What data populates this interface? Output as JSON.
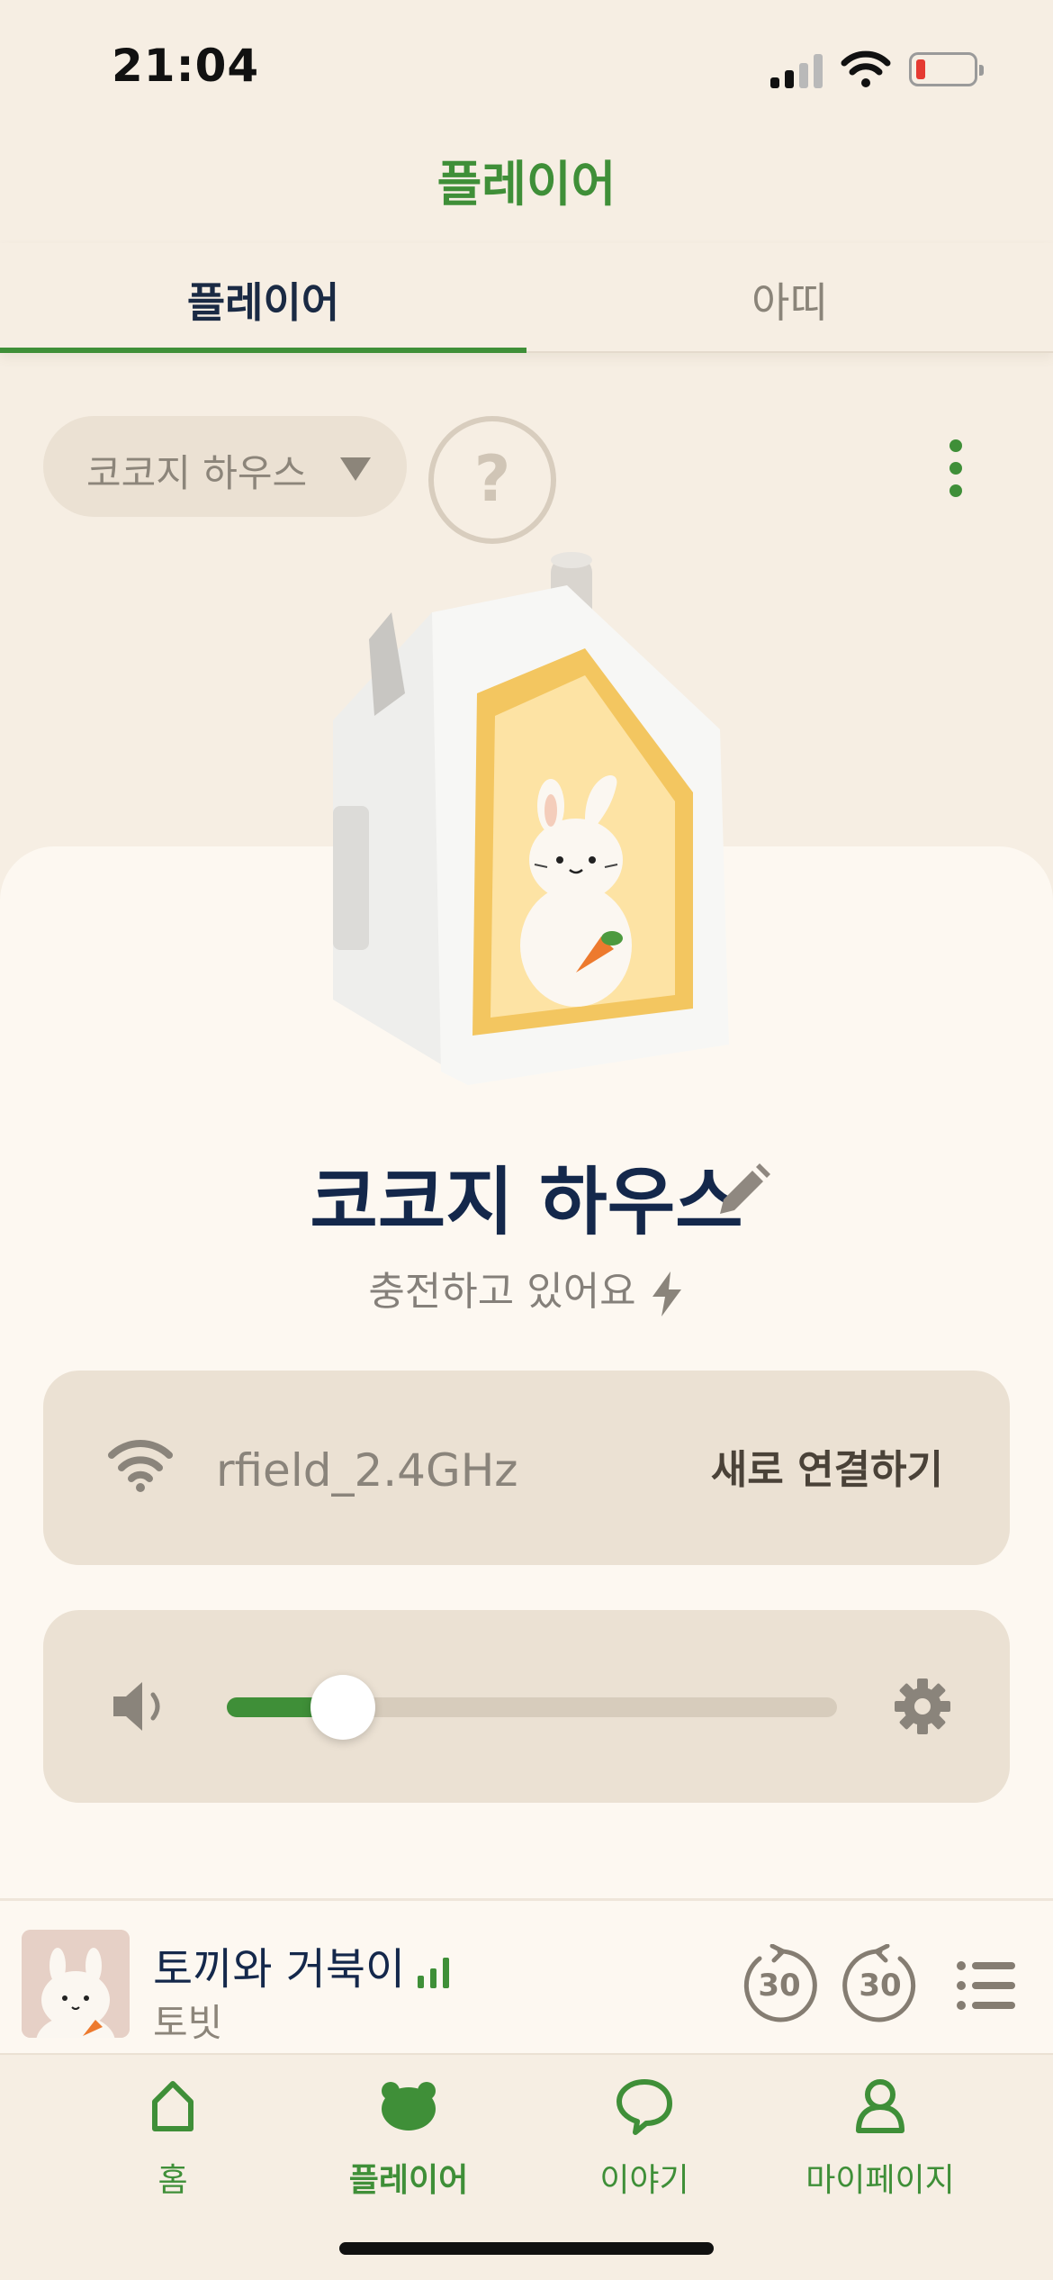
{
  "status_bar": {
    "time": "21:04",
    "battery_color": "#e53a32"
  },
  "header": {
    "title": "플레이어"
  },
  "tabs": [
    {
      "label": "플레이어",
      "active": true
    },
    {
      "label": "아띠",
      "active": false
    }
  ],
  "device_selector": {
    "label": "코코지 하우스",
    "icon": "caret-down-icon"
  },
  "help": {
    "label": "?"
  },
  "device": {
    "name": "코코지 하우스",
    "status": "충전하고 있어요",
    "edit_icon": "pencil-icon",
    "status_icon": "lightning-icon"
  },
  "wifi": {
    "ssid": "rfield_2.4GHz",
    "reconnect_label": "새로 연결하기",
    "icon": "wifi-icon"
  },
  "volume": {
    "level_fraction": 0.19,
    "icon": "speaker-icon",
    "settings_icon": "gear-icon"
  },
  "now_playing": {
    "title": "토끼와 거북이",
    "artist": "토빗",
    "rewind_label": "30",
    "forward_label": "30",
    "rewind_icon": "rewind-30-icon",
    "forward_icon": "forward-30-icon",
    "playlist_icon": "playlist-icon"
  },
  "bottom_nav": [
    {
      "label": "홈",
      "icon": "home-icon",
      "active": false
    },
    {
      "label": "플레이어",
      "icon": "bear-icon",
      "active": true
    },
    {
      "label": "이야기",
      "icon": "chat-bubble-icon",
      "active": false
    },
    {
      "label": "마이페이지",
      "icon": "person-icon",
      "active": false
    }
  ],
  "colors": {
    "accent": "#3f8f38",
    "background": "#f6eee3",
    "card": "#ebe1d3",
    "text_primary": "#14284b"
  }
}
